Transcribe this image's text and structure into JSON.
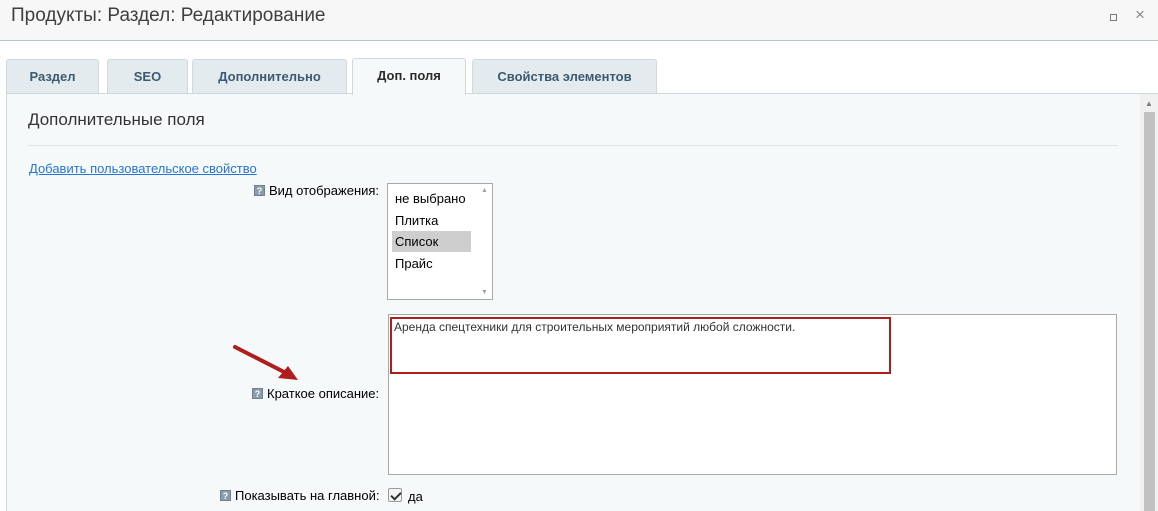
{
  "window": {
    "title": "Продукты: Раздел: Редактирование",
    "maximize_icon": "maximize-icon",
    "close_icon": "close-icon",
    "close_glyph": "×"
  },
  "tabs": [
    {
      "label": "Раздел",
      "active": false
    },
    {
      "label": "SEO",
      "active": false
    },
    {
      "label": "Дополнительно",
      "active": false
    },
    {
      "label": "Доп. поля",
      "active": true
    },
    {
      "label": "Свойства элементов",
      "active": false
    }
  ],
  "section": {
    "title": "Дополнительные поля",
    "add_link": "Добавить пользовательское свойство"
  },
  "fields": {
    "display_view": {
      "label": "Вид отображения:",
      "options": [
        "не выбрано",
        "Плитка",
        "Список",
        "Прайс"
      ],
      "selected": "Список"
    },
    "short_description": {
      "label": "Краткое описание:",
      "value": "Аренда спецтехники для строительных мероприятий любой сложности."
    },
    "show_on_main": {
      "label": "Показывать на главной:",
      "checked": true,
      "text": "да"
    }
  },
  "help_glyph": "?",
  "colors": {
    "link": "#2675d7",
    "tab_text": "#3d5b70",
    "highlight": "#b01d1d",
    "panel_bg": "#f5f9f9"
  }
}
